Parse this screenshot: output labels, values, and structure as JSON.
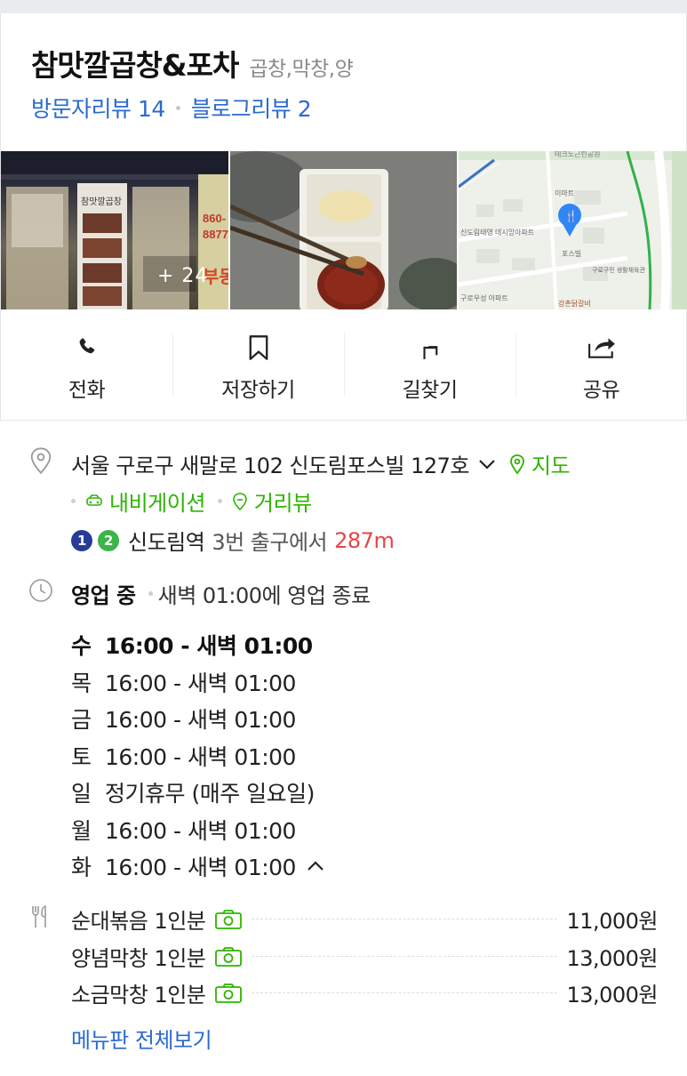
{
  "place": {
    "name": "참맛깔곱창&포차",
    "category": "곱창,막창,양",
    "visitor_reviews": "방문자리뷰 14",
    "blog_reviews": "블로그리뷰 2"
  },
  "photos": {
    "more_count": "+ 24",
    "storefront_sign": "참맛깔곱창",
    "side_sign_top": "860-",
    "side_sign_bottom": "8877",
    "side_sign_text": "부동",
    "map_labels": [
      "이마트",
      "신도림태영 데시앙아파트",
      "포스빌",
      "구로구민 생활체육관",
      "구로우성 아파트",
      "강촌닭갈비",
      "테크노근린공원"
    ]
  },
  "actions": [
    {
      "icon": "phone-icon",
      "label": "전화"
    },
    {
      "icon": "bookmark-icon",
      "label": "저장하기"
    },
    {
      "icon": "directions-icon",
      "label": "길찾기"
    },
    {
      "icon": "share-icon",
      "label": "공유"
    }
  ],
  "address": {
    "text": "서울 구로구 새말로 102 신도림포스빌 127호",
    "map_link": "지도",
    "navigation_link": "내비게이션",
    "streetview_link": "거리뷰"
  },
  "subway": {
    "line1": "1",
    "line2": "2",
    "station": "신도림역",
    "exit_text": "3번 출구에서",
    "distance": "287m",
    "line1_color": "#263c96",
    "line2_color": "#3cb44a"
  },
  "business": {
    "status": "영업 중",
    "close_text": "새벽 01:00에 영업 종료",
    "hours": [
      {
        "day": "수",
        "time": "16:00 - 새벽 01:00"
      },
      {
        "day": "목",
        "time": "16:00 - 새벽 01:00"
      },
      {
        "day": "금",
        "time": "16:00 - 새벽 01:00"
      },
      {
        "day": "토",
        "time": "16:00 - 새벽 01:00"
      },
      {
        "day": "일",
        "time": "정기휴무 (매주 일요일)"
      },
      {
        "day": "월",
        "time": "16:00 - 새벽 01:00"
      },
      {
        "day": "화",
        "time": "16:00 - 새벽 01:00"
      }
    ]
  },
  "menu": {
    "items": [
      {
        "name": "순대볶음 1인분",
        "price": "11,000원"
      },
      {
        "name": "양념막창 1인분",
        "price": "13,000원"
      },
      {
        "name": "소금막창 1인분",
        "price": "13,000원"
      }
    ],
    "view_all": "메뉴판 전체보기"
  },
  "colors": {
    "link_blue": "#2a6ad1",
    "green": "#2db400",
    "distance_red": "#e64545",
    "map_pin_blue": "#2f86f6"
  }
}
